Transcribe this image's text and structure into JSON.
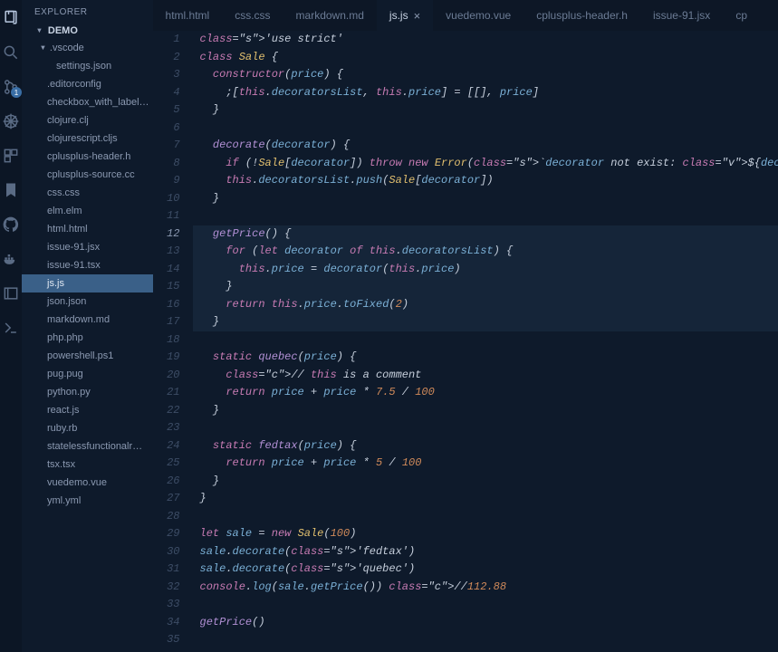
{
  "sidebar": {
    "title": "EXPLORER",
    "folder": "DEMO",
    "items": [
      {
        "label": ".vscode",
        "type": "folder"
      },
      {
        "label": "settings.json",
        "indent": 2
      },
      {
        "label": ".editorconfig"
      },
      {
        "label": "checkbox_with_label…"
      },
      {
        "label": "clojure.clj"
      },
      {
        "label": "clojurescript.cljs"
      },
      {
        "label": "cplusplus-header.h"
      },
      {
        "label": "cplusplus-source.cc"
      },
      {
        "label": "css.css"
      },
      {
        "label": "elm.elm"
      },
      {
        "label": "html.html"
      },
      {
        "label": "issue-91.jsx"
      },
      {
        "label": "issue-91.tsx"
      },
      {
        "label": "js.js",
        "selected": true
      },
      {
        "label": "json.json"
      },
      {
        "label": "markdown.md"
      },
      {
        "label": "php.php"
      },
      {
        "label": "powershell.ps1"
      },
      {
        "label": "pug.pug"
      },
      {
        "label": "python.py"
      },
      {
        "label": "react.js"
      },
      {
        "label": "ruby.rb"
      },
      {
        "label": "statelessfunctionalr…"
      },
      {
        "label": "tsx.tsx"
      },
      {
        "label": "vuedemo.vue"
      },
      {
        "label": "yml.yml"
      }
    ]
  },
  "tabs": [
    {
      "label": "html.html"
    },
    {
      "label": "css.css"
    },
    {
      "label": "markdown.md"
    },
    {
      "label": "js.js",
      "active": true,
      "close": "×"
    },
    {
      "label": "vuedemo.vue"
    },
    {
      "label": "cplusplus-header.h"
    },
    {
      "label": "issue-91.jsx"
    },
    {
      "label": "cp"
    }
  ],
  "activity_badge": "1",
  "editor": {
    "current_line": 12,
    "lines": [
      "'use strict'",
      "class Sale {",
      "  constructor(price) {",
      "    ;[this.decoratorsList, this.price] = [[], price]",
      "  }",
      "",
      "  decorate(decorator) {",
      "    if (!Sale[decorator]) throw new Error(`decorator not exist: ${decorator}`)",
      "    this.decoratorsList.push(Sale[decorator])",
      "  }",
      "",
      "  getPrice() {",
      "    for (let decorator of this.decoratorsList) {",
      "      this.price = decorator(this.price)",
      "    }",
      "    return this.price.toFixed(2)",
      "  }",
      "",
      "  static quebec(price) {",
      "    // this is a comment",
      "    return price + price * 7.5 / 100",
      "  }",
      "",
      "  static fedtax(price) {",
      "    return price + price * 5 / 100",
      "  }",
      "}",
      "",
      "let sale = new Sale(100)",
      "sale.decorate('fedtax')",
      "sale.decorate('quebec')",
      "console.log(sale.getPrice()) //112.88",
      "",
      "getPrice()",
      ""
    ]
  }
}
